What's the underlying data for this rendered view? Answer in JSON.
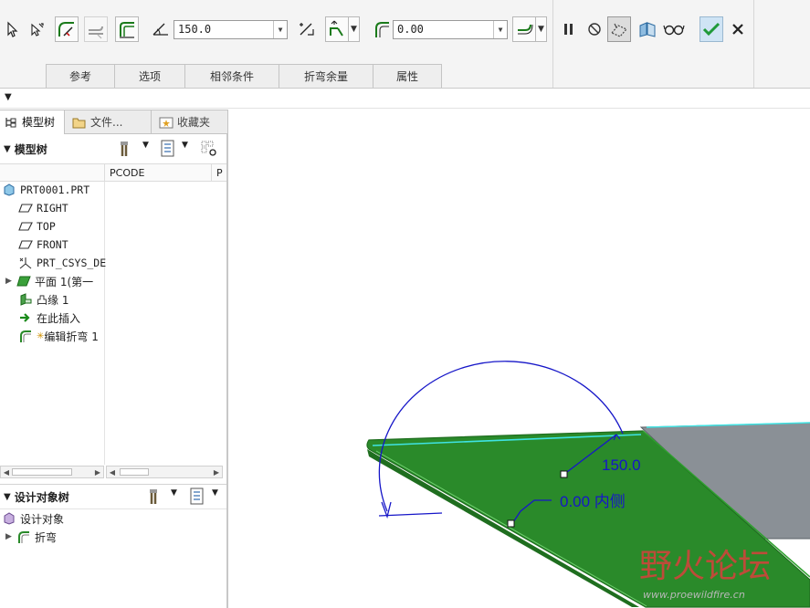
{
  "ribbon": {
    "angle_value": "150.0",
    "radius_value": "0.00",
    "tabs": [
      "参考",
      "选项",
      "相邻条件",
      "折弯余量",
      "属性"
    ]
  },
  "panel": {
    "tabs": [
      "模型树",
      "文件...",
      "收藏夹"
    ],
    "model_tree_title": "模型树",
    "column_header": "PCODE",
    "column_header2": "P",
    "tree_items": [
      {
        "label": "PRT0001.PRT",
        "icon": "part-icon"
      },
      {
        "label": "RIGHT",
        "icon": "datum-plane-icon"
      },
      {
        "label": "TOP",
        "icon": "datum-plane-icon"
      },
      {
        "label": "FRONT",
        "icon": "datum-plane-icon"
      },
      {
        "label": "PRT_CSYS_DE",
        "icon": "csys-icon"
      },
      {
        "label": "平面 1(第一",
        "icon": "flat-wall-icon"
      },
      {
        "label": "凸缘 1",
        "icon": "flange-icon"
      },
      {
        "label": "在此插入",
        "icon": "insert-here-arrow-icon"
      },
      {
        "label": "编辑折弯 1",
        "icon": "edit-bend-icon"
      }
    ],
    "design_tree_title": "设计对象树",
    "design_items": [
      {
        "label": "设计对象",
        "icon": "design-object-icon"
      },
      {
        "label": "折弯",
        "icon": "bend-icon"
      }
    ]
  },
  "viewport": {
    "angle_label": "150.0",
    "radius_label": "0.00 内侧",
    "watermark_text": "野火论坛",
    "watermark_url": "www.proewildfire.cn"
  },
  "colors": {
    "sheet_green": "#2a8a2a",
    "sheet_edge": "#1f6e1f",
    "highlight": "#3fe3e3",
    "dimension": "#1616c8",
    "confirm_check": "#1f9a3a",
    "watermark": "#d8403c"
  }
}
